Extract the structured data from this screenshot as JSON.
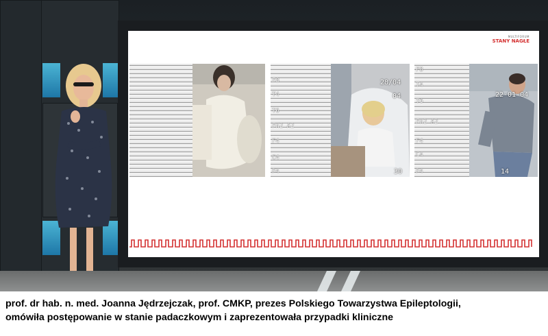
{
  "slide": {
    "logo_small": "MULTIFORUM",
    "logo_main": "STANY NAGŁE",
    "accent_color": "#d43030"
  },
  "video_panels": [
    {
      "channel_labels": [],
      "timestamp": ""
    },
    {
      "channel_labels": [
        "F8",
        "T4",
        "T6",
        "Fn2 A2",
        "F4",
        "C4",
        "P4"
      ],
      "date_stamp": "28/04",
      "time_stamp": "04",
      "bottom_stamp": "30"
    },
    {
      "channel_labels": [
        "F8",
        "T4",
        "T6",
        "Fn2 A2",
        "F4",
        "C4",
        "P4"
      ],
      "date_stamp": "22-01-04",
      "bottom_stamp": "14"
    }
  ],
  "caption": {
    "line1": "prof. dr hab. n. med. Joanna Jędrzejczak, prof. CMKP, prezes Polskiego Towarzystwa Epileptologii,",
    "line2": "omówiła postępowanie w stanie padaczkowym i zaprezentowała przypadki kliniczne"
  }
}
